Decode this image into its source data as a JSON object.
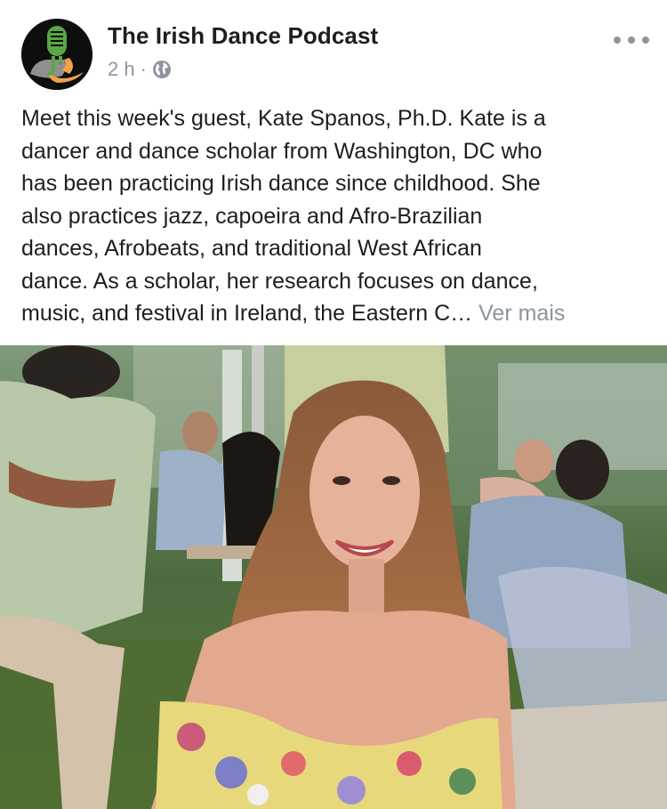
{
  "post": {
    "page_name": "The Irish Dance Podcast",
    "time": "2 h",
    "separator": "·",
    "audience_icon": "globe-icon",
    "more_icon": "more-options-icon",
    "text_lines": [
      "Meet this week's guest, Kate Spanos, Ph.D.   Kate is a",
      "dancer and dance scholar from Washington, DC who",
      "has been practicing Irish dance since childhood. She",
      "also practices jazz, capoeira and Afro-Brazilian",
      "dances, Afrobeats, and traditional West African",
      "dance. As a scholar, her research focuses on dance,",
      "music, and festival in Ireland, the Eastern C…"
    ],
    "see_more": "Ver mais"
  },
  "colors": {
    "text": "#1c1e21",
    "secondary": "#8d949e",
    "avatar_bg": "#0d0f0e",
    "logo_green": "#5aa646",
    "logo_orange": "#f0a24a"
  },
  "photo": {
    "subject": "smiling woman with long auburn hair at an outdoor evening event"
  }
}
